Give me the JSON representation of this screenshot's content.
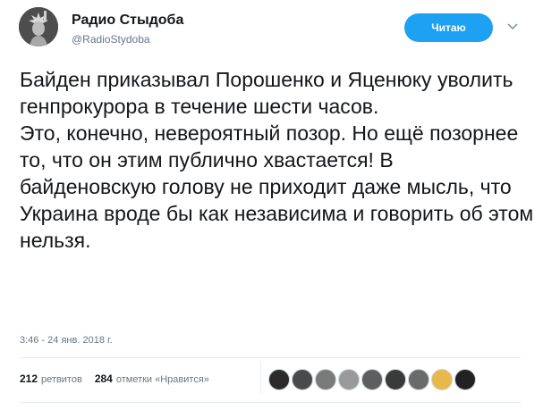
{
  "account": {
    "name": "Радио Стыдоба",
    "handle": "@RadioStydoba",
    "avatar_icon": "statue-of-liberty-avatar"
  },
  "follow_button": {
    "label": "Читаю",
    "color": "#1da1f2"
  },
  "menu_icon": "chevron-down-icon",
  "tweet": {
    "paragraphs": [
      "Байден приказывал Порошенко и Яценюку уволить генпрокурора в течение шести часов.",
      "Это, конечно, невероятный позор. Но ещё позорнее то, что он этим публично хвастается! В байденовскую голову не приходит даже мысль, что Украина вроде бы как независима и говорить об этом нельзя."
    ]
  },
  "timestamp": "3:46 - 24 янв. 2018 г.",
  "stats": {
    "retweets_count": "212",
    "retweets_label": "ретвитов",
    "likes_count": "284",
    "likes_label": "отметки «Нравится»"
  },
  "likers": [
    {
      "name": "liker-avatar-1",
      "color": "#2b2b2b"
    },
    {
      "name": "liker-avatar-2",
      "color": "#4a4a4a"
    },
    {
      "name": "liker-avatar-3",
      "color": "#7a7a7a"
    },
    {
      "name": "liker-avatar-4",
      "color": "#9a9a9a"
    },
    {
      "name": "liker-avatar-5",
      "color": "#5e5e5e"
    },
    {
      "name": "liker-avatar-6",
      "color": "#3a3a3a"
    },
    {
      "name": "liker-avatar-7",
      "color": "#6a6a6a"
    },
    {
      "name": "liker-avatar-8",
      "color": "#e8b84a"
    },
    {
      "name": "liker-avatar-9",
      "color": "#222222"
    }
  ]
}
